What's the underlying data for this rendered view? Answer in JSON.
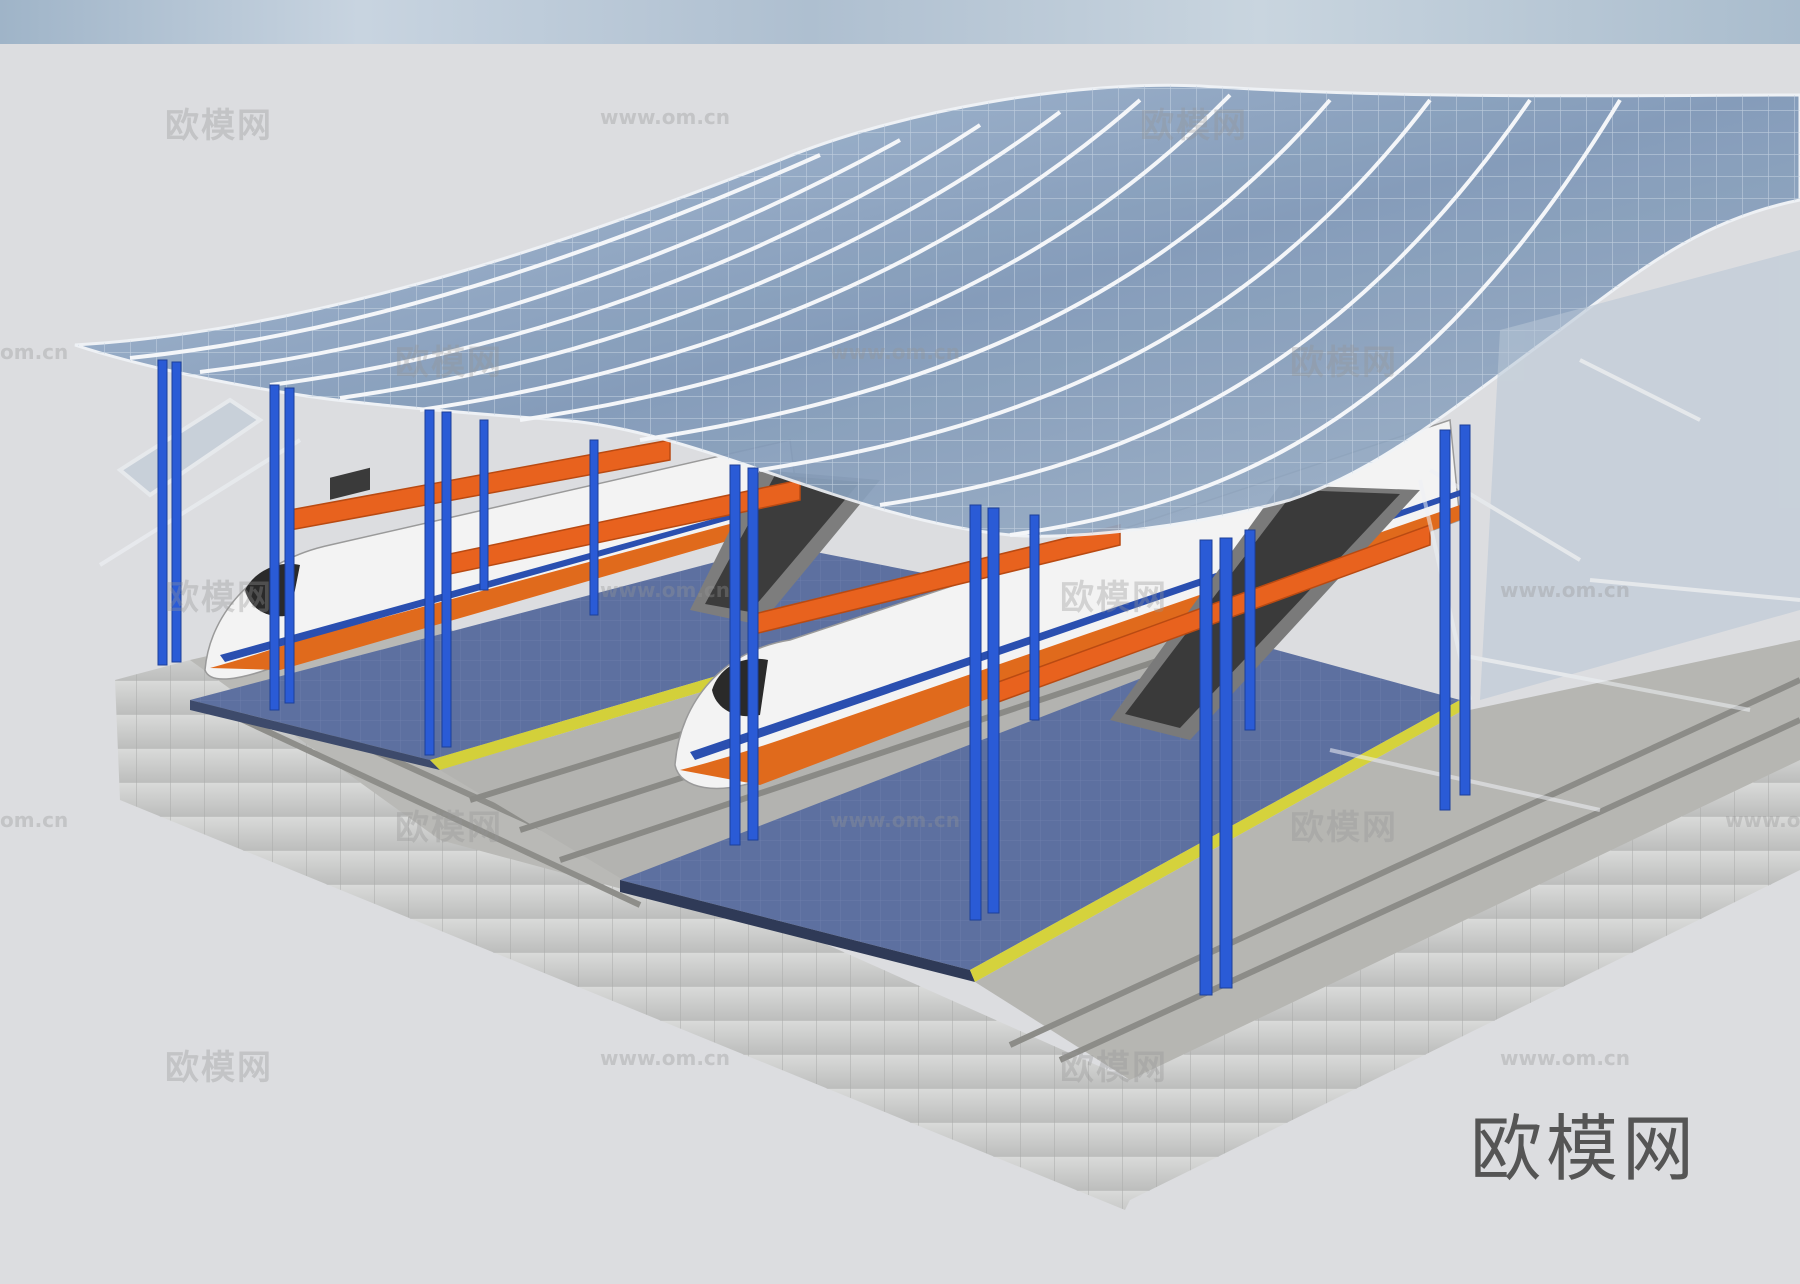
{
  "watermark": {
    "brand_cn": "欧模网",
    "url": "www.om.cn",
    "url_partial": "om.cn"
  },
  "brand_label": "欧模网",
  "colors": {
    "background": "#dcdde0",
    "columns": "#2a5bd6",
    "beams": "#e8621e",
    "roof_glass": "#8fa6c2",
    "platform": "#5b6e9a",
    "concrete": "#cfd0cf",
    "train_body": "#f4f4f4",
    "train_stripe": "#e06a1c"
  }
}
